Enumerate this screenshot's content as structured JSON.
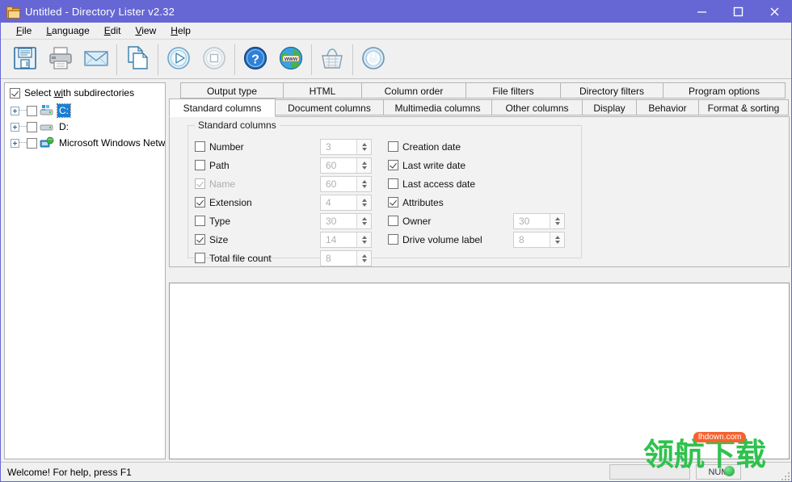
{
  "window": {
    "title": "Untitled - Directory Lister v2.32",
    "icon": "folder-icon",
    "controls": {
      "minimize": "minimize-icon",
      "maximize": "maximize-icon",
      "close": "close-icon"
    }
  },
  "menubar": {
    "items": [
      {
        "label": "File",
        "accel": "F"
      },
      {
        "label": "Language",
        "accel": "L"
      },
      {
        "label": "Edit",
        "accel": "E"
      },
      {
        "label": "View",
        "accel": "V"
      },
      {
        "label": "Help",
        "accel": "H"
      }
    ]
  },
  "toolbar": {
    "buttons": [
      {
        "name": "save-icon",
        "tooltip": "Save"
      },
      {
        "name": "print-icon",
        "tooltip": "Print"
      },
      {
        "name": "email-icon",
        "tooltip": "Email"
      },
      {
        "name": "copy-icon",
        "tooltip": "Copy"
      },
      {
        "name": "start-icon",
        "tooltip": "Start"
      },
      {
        "name": "stop-icon",
        "tooltip": "Stop"
      },
      {
        "name": "help-icon",
        "tooltip": "Help"
      },
      {
        "name": "www-icon",
        "tooltip": "Website"
      },
      {
        "name": "buy-basket-icon",
        "tooltip": "Buy"
      },
      {
        "name": "exit-power-icon",
        "tooltip": "Exit"
      }
    ]
  },
  "tree_panel": {
    "select_with_subdirectories": {
      "label": "Select with subdirectories",
      "accel": "wi",
      "checked": true
    },
    "nodes": [
      {
        "label": "C:",
        "icon": "drive-windows-icon",
        "checked": false,
        "selected": true
      },
      {
        "label": "D:",
        "icon": "drive-icon",
        "checked": false,
        "selected": false
      },
      {
        "label": "Microsoft Windows Network",
        "icon": "network-icon",
        "checked": false,
        "selected": false
      }
    ]
  },
  "tabs": {
    "row1": [
      {
        "label": "Output type",
        "active": false,
        "width": 128
      },
      {
        "label": "HTML",
        "active": false,
        "width": 98
      },
      {
        "label": "Column order",
        "active": false,
        "width": 130
      },
      {
        "label": "File filters",
        "active": false,
        "width": 118
      },
      {
        "label": "Directory filters",
        "active": false,
        "width": 128
      },
      {
        "label": "Program options",
        "active": false,
        "width": 152
      }
    ],
    "row2": [
      {
        "label": "Standard columns",
        "active": true,
        "width": 132
      },
      {
        "label": "Document columns",
        "active": false,
        "width": 135
      },
      {
        "label": "Multimedia columns",
        "active": false,
        "width": 135
      },
      {
        "label": "Other columns",
        "active": false,
        "width": 113
      },
      {
        "label": "Display",
        "active": false,
        "width": 68
      },
      {
        "label": "Behavior",
        "active": false,
        "width": 78
      },
      {
        "label": "Format & sorting",
        "active": false,
        "width": 112
      }
    ]
  },
  "standard_columns": {
    "group_title": "Standard columns",
    "left_options": [
      {
        "label": "Number",
        "checked": false,
        "disabled": false,
        "width_value": "3",
        "has_spinner": true
      },
      {
        "label": "Path",
        "checked": false,
        "disabled": false,
        "width_value": "60",
        "has_spinner": true
      },
      {
        "label": "Name",
        "checked": true,
        "disabled": true,
        "width_value": "60",
        "has_spinner": true
      },
      {
        "label": "Extension",
        "checked": true,
        "disabled": false,
        "width_value": "4",
        "has_spinner": true
      },
      {
        "label": "Type",
        "checked": false,
        "disabled": false,
        "width_value": "30",
        "has_spinner": true
      },
      {
        "label": "Size",
        "checked": true,
        "disabled": false,
        "width_value": "14",
        "has_spinner": true
      },
      {
        "label": "Total file count",
        "checked": false,
        "disabled": false,
        "width_value": "8",
        "has_spinner": true
      }
    ],
    "right_options": [
      {
        "label": "Creation date",
        "checked": false,
        "disabled": false,
        "width_value": "",
        "has_spinner": false
      },
      {
        "label": "Last write date",
        "checked": true,
        "disabled": false,
        "width_value": "",
        "has_spinner": false
      },
      {
        "label": "Last access date",
        "checked": false,
        "disabled": false,
        "width_value": "",
        "has_spinner": false
      },
      {
        "label": "Attributes",
        "checked": true,
        "disabled": false,
        "width_value": "",
        "has_spinner": false
      },
      {
        "label": "Owner",
        "checked": false,
        "disabled": false,
        "width_value": "30",
        "has_spinner": true
      },
      {
        "label": "Drive volume label",
        "checked": false,
        "disabled": false,
        "width_value": "8",
        "has_spinner": true
      }
    ]
  },
  "preview": {
    "content": ""
  },
  "statusbar": {
    "message": "Welcome! For help, press F1",
    "num_indicator": "NUM"
  },
  "watermark": {
    "text": "领航下载",
    "badge": "lhdown.com"
  },
  "colors": {
    "titlebar": "#6667d4",
    "selection": "#1a7fd4",
    "panel": "#f0f0f0",
    "tab_active": "#ffffff",
    "watermark_green": "#2fc24d",
    "watermark_badge": "#f5622e"
  }
}
